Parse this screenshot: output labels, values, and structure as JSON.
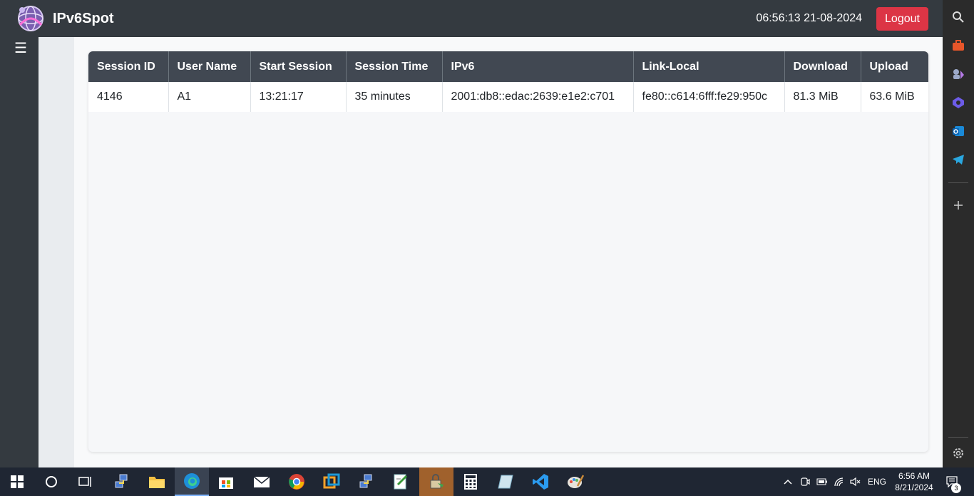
{
  "app": {
    "brand": "IPv6Spot",
    "clock": "06:56:13 21-08-2024",
    "logout_label": "Logout",
    "menu_icon": "☰"
  },
  "table": {
    "headers": [
      "Session ID",
      "User Name",
      "Start Session",
      "Session Time",
      "IPv6",
      "Link-Local",
      "Download",
      "Upload"
    ],
    "rows": [
      [
        "4146",
        "A1",
        "13:21:17",
        "35 minutes",
        "2001:db8::edac:2639:e1e2:c701",
        "fe80::c614:6fff:fe29:950c",
        "81.3 MiB",
        "63.6 MiB"
      ]
    ]
  },
  "edge_sidebar": {
    "icons": [
      "search-icon",
      "toolbox-icon",
      "games-icon",
      "copilot-icon",
      "outlook-icon",
      "telegram-icon",
      "add-icon",
      "settings-icon"
    ]
  },
  "taskbar": {
    "apps": [
      "start-icon",
      "search-icon",
      "task-view-icon",
      "network-app-icon",
      "file-explorer-icon",
      "edge-icon",
      "store-icon",
      "mail-icon",
      "chrome-icon",
      "virtualbox-icon",
      "network-app-2-icon",
      "notepad-icon",
      "lock-app-icon",
      "calculator-icon",
      "notes-icon",
      "vscode-icon",
      "paint-icon"
    ],
    "language": "ENG",
    "time": "6:56 AM",
    "date": "8/21/2024",
    "notifications": "3"
  },
  "colors": {
    "header_bg": "#343a40",
    "table_header_bg": "#414852",
    "logout_bg": "#dc3545",
    "taskbar_bg": "#1f2633"
  }
}
